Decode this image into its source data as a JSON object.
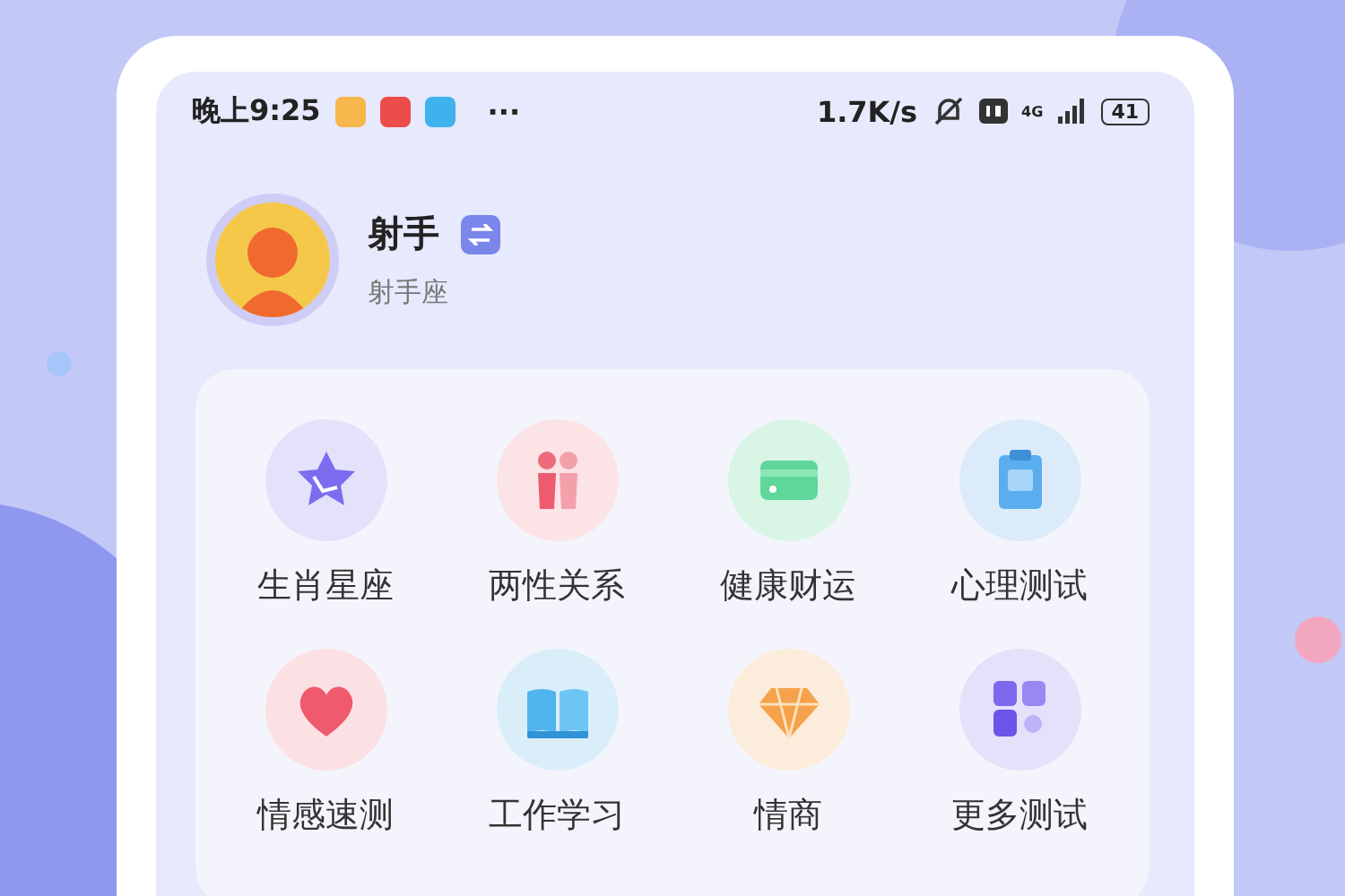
{
  "status_bar": {
    "time": "晚上9:25",
    "notifications": [
      {
        "kind": "note"
      },
      {
        "kind": "news"
      },
      {
        "kind": "chat"
      }
    ],
    "more": "···",
    "speed": "1.7K/s",
    "network": "4G",
    "battery": "41"
  },
  "profile": {
    "name": "射手",
    "sign": "射手座"
  },
  "grid": {
    "items": [
      {
        "label": "生肖星座",
        "kind": "star"
      },
      {
        "label": "两性关系",
        "kind": "couple"
      },
      {
        "label": "健康财运",
        "kind": "card"
      },
      {
        "label": "心理测试",
        "kind": "clipboard"
      },
      {
        "label": "情感速测",
        "kind": "heart"
      },
      {
        "label": "工作学习",
        "kind": "book"
      },
      {
        "label": "情商",
        "kind": "diamond"
      },
      {
        "label": "更多测试",
        "kind": "blocks"
      }
    ]
  }
}
